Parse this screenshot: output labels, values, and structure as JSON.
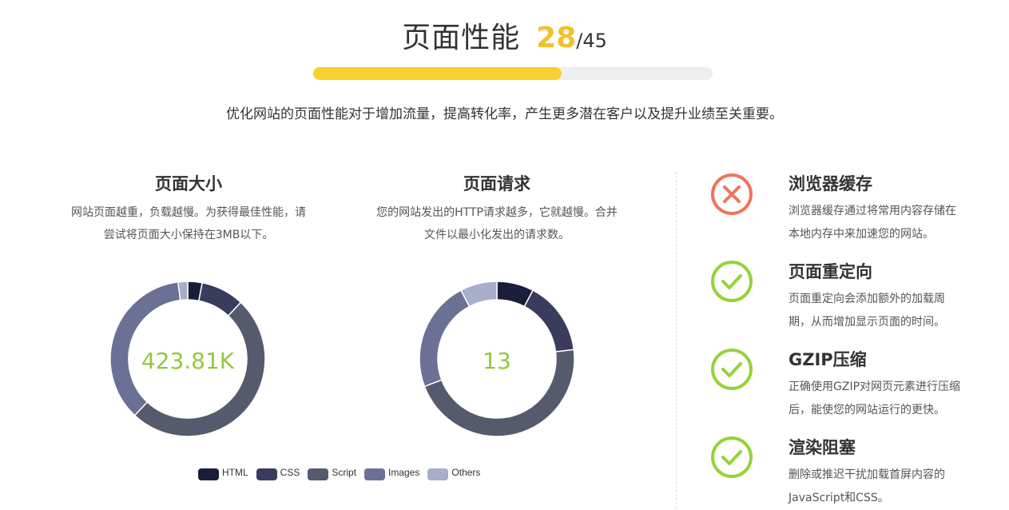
{
  "header": {
    "title": "页面性能",
    "score": "28",
    "max": "/45",
    "progress_fraction": 0.622,
    "subtitle": "优化网站的页面性能对于增加流量，提高转化率，产生更多潜在客户以及提升业绩至关重要。"
  },
  "panels": [
    {
      "title": "页面大小",
      "desc_line1": "网站页面越重，负载越慢。为获得最佳性能，请",
      "desc_line2": "尝试将页面大小保持在3MB以下。",
      "center_value": "423.81K"
    },
    {
      "title": "页面请求",
      "desc_line1": "您的网站发出的HTTP请求越多，它就越慢。合并",
      "desc_line2": "文件以最小化发出的请求数。",
      "center_value": "13"
    }
  ],
  "chart_data": [
    {
      "type": "pie",
      "categories": [
        "HTML",
        "CSS",
        "Script",
        "Images",
        "Others"
      ],
      "values": [
        3,
        9,
        50,
        36,
        2
      ],
      "colors": [
        "#1b1e38",
        "#393c5d",
        "#555a6d",
        "#6b7095",
        "#a7aec9"
      ]
    },
    {
      "type": "pie",
      "categories": [
        "HTML",
        "CSS",
        "Script",
        "Images",
        "Others"
      ],
      "values": [
        1,
        2,
        6,
        3,
        1
      ],
      "colors": [
        "#1b1e38",
        "#393c5d",
        "#555a6d",
        "#6b7095",
        "#a7aec9"
      ]
    }
  ],
  "legend": [
    {
      "label": "HTML",
      "color": "#1b1e38"
    },
    {
      "label": "CSS",
      "color": "#393c5d"
    },
    {
      "label": "Script",
      "color": "#555a6d"
    },
    {
      "label": "Images",
      "color": "#6b7095"
    },
    {
      "label": "Others",
      "color": "#a7aec9"
    }
  ],
  "checks": [
    {
      "title": "浏览器缓存",
      "line1": "浏览器缓存通过将常用内容存储在",
      "line2": "本地内存中来加速您的网站。",
      "status": "fail",
      "icon": "x-circle-icon"
    },
    {
      "title": "页面重定向",
      "line1": "页面重定向会添加额外的加载周",
      "line2": "期，从而增加显示页面的时间。",
      "status": "pass",
      "icon": "check-circle-icon"
    },
    {
      "title": "GZIP压缩",
      "line1": "正确使用GZIP对网页元素进行压缩",
      "line2": "后，能使您的网站运行的更快。",
      "status": "pass",
      "icon": "check-circle-icon"
    },
    {
      "title": "渲染阻塞",
      "line1": "删除或推迟干扰加载首屏内容的",
      "line2": "JavaScript和CSS。",
      "status": "pass",
      "icon": "check-circle-icon"
    }
  ],
  "colors": {
    "pass": "#95d33a",
    "fail": "#f0745a",
    "score": "#f2c12e",
    "progress": "#f8d030",
    "center": "#93c93b"
  }
}
